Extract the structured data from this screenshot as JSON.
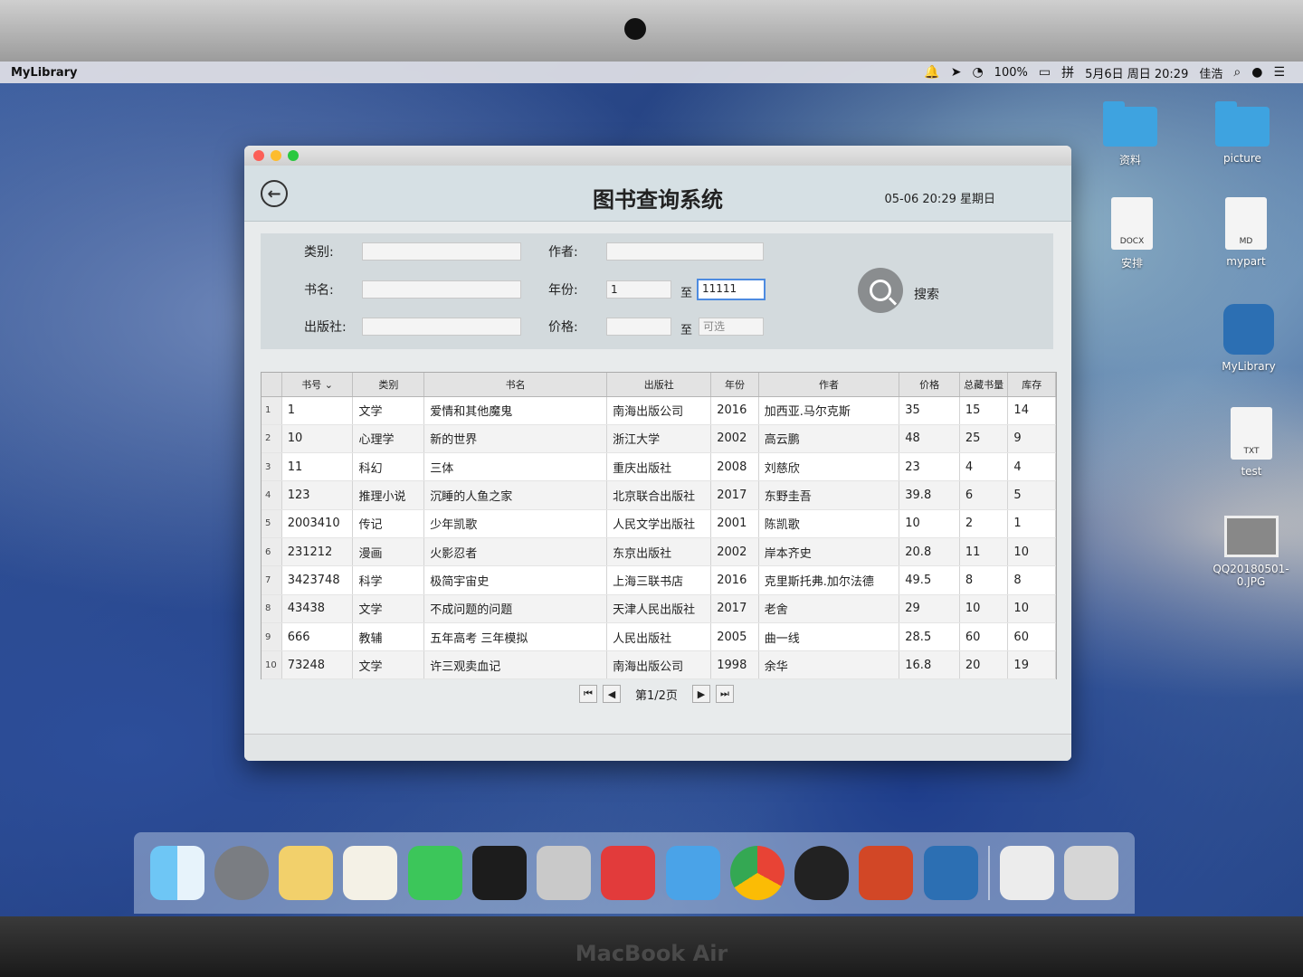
{
  "menubar": {
    "app_name": "MyLibrary",
    "battery": "100%",
    "datetime": "5月6日 周日 20:29",
    "user": "佳浩"
  },
  "desktop": {
    "icons": [
      {
        "label": "资料",
        "kind": "folder"
      },
      {
        "label": "picture",
        "kind": "folder"
      },
      {
        "label": "安排",
        "kind": "doc",
        "tag": "DOCX"
      },
      {
        "label": "mypart",
        "kind": "doc",
        "tag": "MD"
      },
      {
        "label": "MyLibrary",
        "kind": "app"
      },
      {
        "label": "test",
        "kind": "doc",
        "tag": "TXT"
      },
      {
        "label": "QQ20180501-0.JPG",
        "kind": "image"
      }
    ]
  },
  "window": {
    "title": "图书查询系统",
    "clock": "05-06 20:29 星期日",
    "filters": {
      "category_label": "类别:",
      "category_value": "",
      "author_label": "作者:",
      "author_value": "",
      "name_label": "书名:",
      "name_value": "",
      "year_label": "年份:",
      "year_from": "1",
      "year_to": "11111",
      "to_label": "至",
      "publisher_label": "出版社:",
      "publisher_value": "",
      "price_label": "价格:",
      "price_from": "",
      "price_to_placeholder": "可选",
      "search_label": "搜索"
    },
    "table": {
      "columns": [
        "书号",
        "类别",
        "书名",
        "出版社",
        "年份",
        "作者",
        "价格",
        "总藏书量",
        "库存"
      ],
      "rows": [
        [
          "1",
          "1",
          "文学",
          "爱情和其他魔鬼",
          "南海出版公司",
          "2016",
          "加西亚.马尔克斯",
          "35",
          "15",
          "14"
        ],
        [
          "2",
          "10",
          "心理学",
          "新的世界",
          "浙江大学",
          "2002",
          "高云鹏",
          "48",
          "25",
          "9"
        ],
        [
          "3",
          "11",
          "科幻",
          "三体",
          "重庆出版社",
          "2008",
          "刘慈欣",
          "23",
          "4",
          "4"
        ],
        [
          "4",
          "123",
          "推理小说",
          "沉睡的人鱼之家",
          "北京联合出版社",
          "2017",
          "东野圭吾",
          "39.8",
          "6",
          "5"
        ],
        [
          "5",
          "2003410",
          "传记",
          "少年凯歌",
          "人民文学出版社",
          "2001",
          "陈凯歌",
          "10",
          "2",
          "1"
        ],
        [
          "6",
          "231212",
          "漫画",
          "火影忍者",
          "东京出版社",
          "2002",
          "岸本齐史",
          "20.8",
          "11",
          "10"
        ],
        [
          "7",
          "3423748",
          "科学",
          "极简宇宙史",
          "上海三联书店",
          "2016",
          "克里斯托弗.加尔法德",
          "49.5",
          "8",
          "8"
        ],
        [
          "8",
          "43438",
          "文学",
          "不成问题的问题",
          "天津人民出版社",
          "2017",
          "老舍",
          "29",
          "10",
          "10"
        ],
        [
          "9",
          "666",
          "教辅",
          "五年高考 三年模拟",
          "人民出版社",
          "2005",
          "曲一线",
          "28.5",
          "60",
          "60"
        ],
        [
          "10",
          "73248",
          "文学",
          "许三观卖血记",
          "南海出版公司",
          "1998",
          "余华",
          "16.8",
          "20",
          "19"
        ]
      ]
    },
    "pager": {
      "page_label": "第1/2页"
    }
  },
  "laptop": {
    "brand": "MacBook Air"
  },
  "colors": {
    "window_bg": "#e8ebec",
    "header_bg": "#d6e0e4",
    "active_border": "#4d8be0"
  }
}
